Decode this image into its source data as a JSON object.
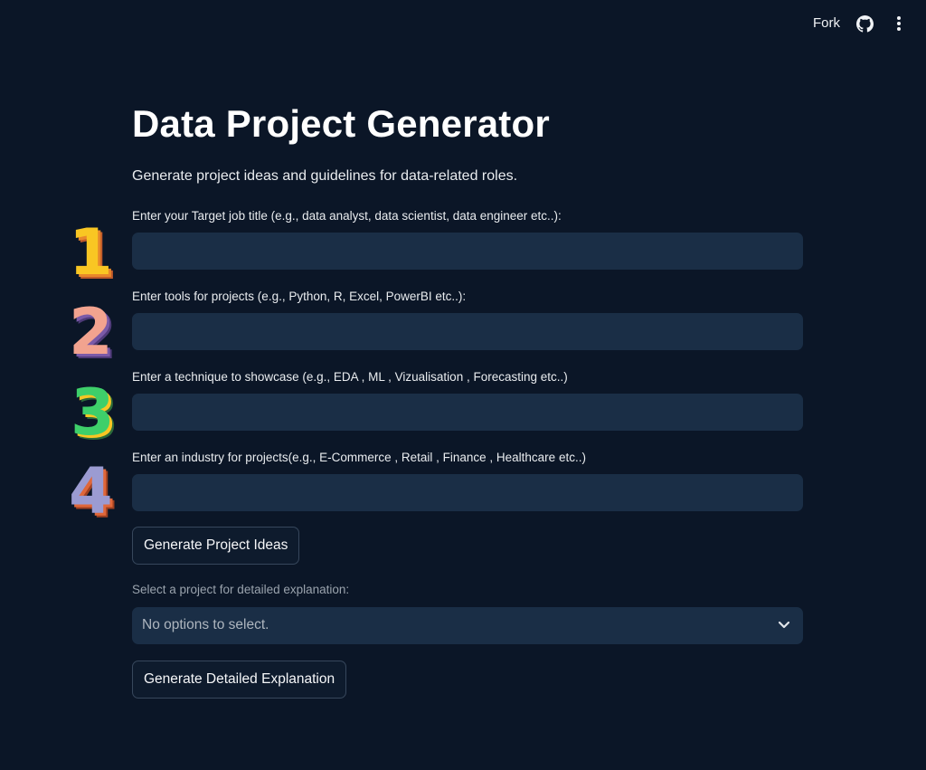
{
  "header": {
    "fork_label": "Fork",
    "github_icon": "github-icon",
    "menu_icon": "more-vertical-icon"
  },
  "main": {
    "title": "Data Project Generator",
    "subtitle": "Generate project ideas and guidelines for data-related roles.",
    "fields": [
      {
        "label": "Enter your Target job title (e.g., data analyst, data scientist, data engineer etc..):",
        "value": ""
      },
      {
        "label": "Enter tools for projects (e.g., Python, R, Excel, PowerBI etc..):",
        "value": ""
      },
      {
        "label": "Enter a technique to showcase (e.g., EDA , ML , Vizualisation , Forecasting etc..)",
        "value": ""
      },
      {
        "label": "Enter an industry for projects(e.g., E-Commerce , Retail , Finance , Healthcare etc..)",
        "value": ""
      }
    ],
    "generate_button": "Generate Project Ideas",
    "select": {
      "label": "Select a project for detailed explanation:",
      "value": "No options to select."
    },
    "explain_button": "Generate Detailed Explanation"
  },
  "annotations": {
    "numbers": [
      "1",
      "2",
      "3",
      "4"
    ],
    "colors": [
      "#f9c623",
      "#f2a38f",
      "#3ecf6a",
      "#9b9bd2"
    ],
    "shadow_colors": [
      "#e8872b",
      "#7a5aa8",
      "#2c6a3a",
      "#e0673a"
    ]
  },
  "theme": {
    "background": "#0b1627",
    "input_background": "#1a2e46",
    "button_border": "#37475c"
  }
}
